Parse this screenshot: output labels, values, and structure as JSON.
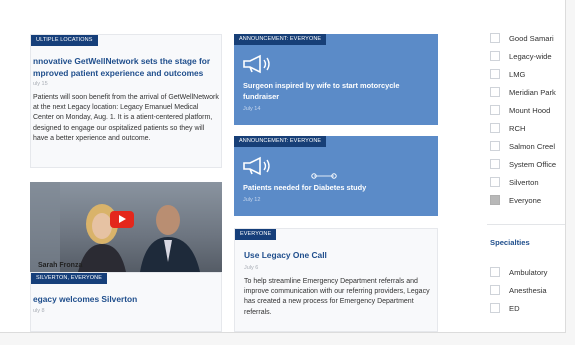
{
  "cards": {
    "left_top": {
      "tag": "ULTIPLE LOCATIONS",
      "title": "nnovative GetWellNetwork sets the stage for mproved patient experience and outcomes",
      "date": "uly 15",
      "body": "Patients will soon benefit from the arrival of GetWellNetwork at the next Legacy location: Legacy Emanuel Medical Center on Monday, Aug. 1. It is a atient-centered platform, designed to engage our ospitalized patients so they will have a better xperience and outcome."
    },
    "video": {
      "caption": "Sarah Fronza"
    },
    "left_bottom": {
      "tag": "SILVERTON, EVERYONE",
      "title": "egacy welcomes Silverton",
      "date": "uly 8"
    },
    "blue_1": {
      "tag": "ANNOUNCEMENT: EVERYONE",
      "title": "Surgeon inspired by wife to start motorcycle fundraiser",
      "date": "July 14"
    },
    "blue_2": {
      "tag": "ANNOUNCEMENT: EVERYONE",
      "title": "Patients needed for Diabetes study",
      "date": "July 12"
    },
    "mid_bottom": {
      "tag": "EVERYONE",
      "title": "Use Legacy One Call",
      "date": "July 6",
      "body": "To help streamline Emergency Department referrals and improve communication with our referring providers, Legacy has created a new process for Emergency Department referrals."
    }
  },
  "sidebar": {
    "locations": [
      {
        "label": "Good Samari",
        "checked": false
      },
      {
        "label": "Legacy-wide",
        "checked": false
      },
      {
        "label": "LMG",
        "checked": false
      },
      {
        "label": "Meridian Park",
        "checked": false
      },
      {
        "label": "Mount Hood",
        "checked": false
      },
      {
        "label": "RCH",
        "checked": false
      },
      {
        "label": "Salmon Creel",
        "checked": false
      },
      {
        "label": "System Office",
        "checked": false
      },
      {
        "label": "Silverton",
        "checked": false
      },
      {
        "label": "Everyone",
        "checked": true
      }
    ],
    "specialties_heading": "Specialties",
    "specialties": [
      {
        "label": "Ambulatory",
        "checked": false
      },
      {
        "label": "Anesthesia",
        "checked": false
      },
      {
        "label": "ED",
        "checked": false
      }
    ]
  },
  "colors": {
    "tag_navy": "#163f7a",
    "announcement_blue": "#5b8bc8",
    "title_blue": "#1f4e8c",
    "play_red": "#e4271c"
  }
}
